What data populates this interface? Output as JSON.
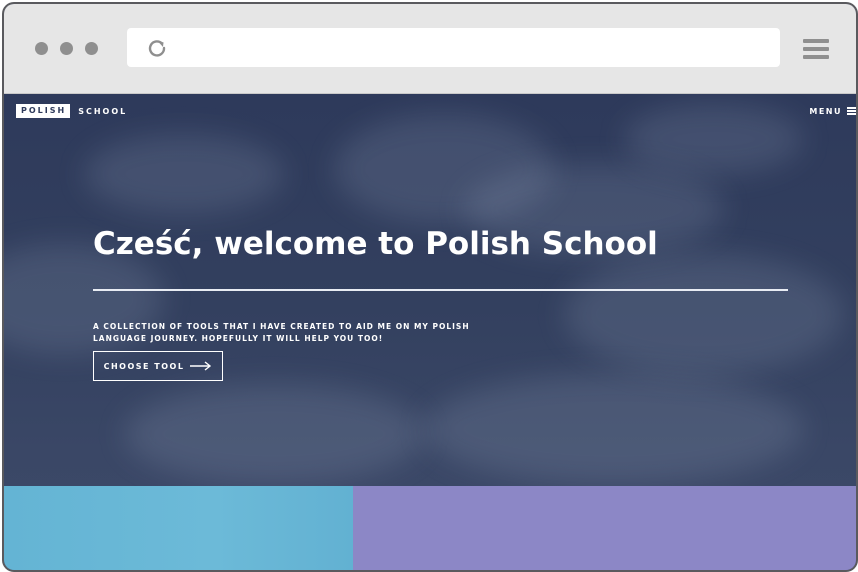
{
  "browser": {
    "url": "",
    "dots": [
      "window-dot-1",
      "window-dot-2",
      "window-dot-3"
    ]
  },
  "site": {
    "brand_box": "POLISH",
    "brand_text": "SCHOOL",
    "menu_label": "MENU",
    "hero_title": "Cześć, welcome to Polish School",
    "hero_subtitle": "A collection of tools that I have created to aid me on my Polish language journey. Hopefully it will help you too!",
    "cta_label": "CHOOSE TOOL",
    "tiles": [
      "tile-left",
      "tile-right"
    ]
  },
  "colors": {
    "hero_overlay": "#2e3a5b",
    "tile_left": "#64b4d4",
    "tile_right": "#8c87c6",
    "chrome": "#e6e6e6"
  },
  "icons": {
    "reload": "reload-icon",
    "browser_menu": "hamburger-menu-icon",
    "site_menu": "menu-icon",
    "cta_arrow": "arrow-right-icon"
  }
}
